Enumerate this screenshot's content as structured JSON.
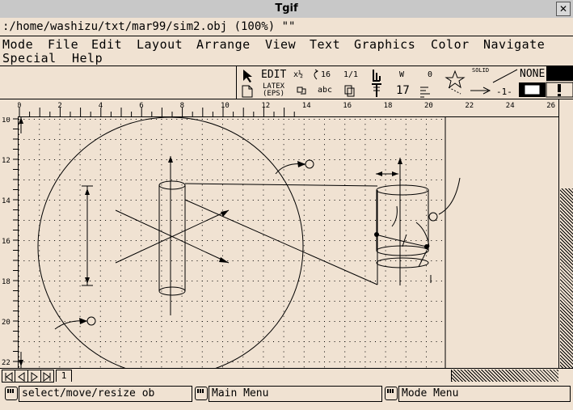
{
  "window": {
    "title": "Tgif",
    "path": ":/home/washizu/txt/mar99/sim2.obj (100%) \"\""
  },
  "menubar": {
    "row1": [
      "Mode",
      "File",
      "Edit",
      "Layout",
      "Arrange",
      "View",
      "Text",
      "Graphics",
      "Color",
      "Navigate"
    ],
    "row2": [
      "Special",
      "Help"
    ]
  },
  "toolbar": {
    "edit_label": "EDIT",
    "zoom_label": "x½",
    "rotate_label": "16",
    "ratio_label": "1/1",
    "latex_label": "LATEX",
    "eps_label": "(EPS)",
    "text_abc": "abc",
    "width_label": "W",
    "width_value": "17",
    "solid_label": "SOLID",
    "dash_label": "-1-",
    "fill_label": "NONE",
    "spline_label": "0"
  },
  "ruler": {
    "h_ticks": [
      "0",
      "2",
      "4",
      "6",
      "8",
      "10",
      "12",
      "14",
      "16",
      "18",
      "20",
      "22",
      "24",
      "26"
    ],
    "v_ticks": [
      "10",
      "12",
      "14",
      "16",
      "18",
      "20",
      "22"
    ]
  },
  "pagebar": {
    "page_tab": "1"
  },
  "status": {
    "left": "select/move/resize ob",
    "middle": "Main Menu",
    "right": "Mode Menu"
  }
}
